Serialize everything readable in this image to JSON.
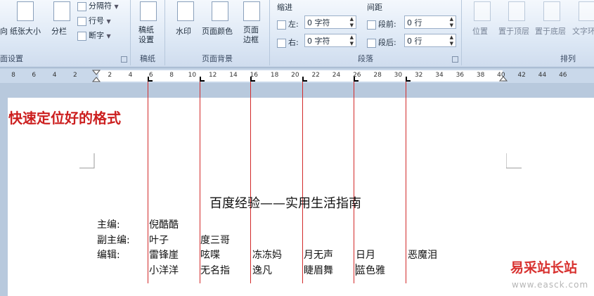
{
  "ribbon": {
    "page_setup": {
      "label": "面设置",
      "left_label": "向",
      "paper_size": "纸张大小",
      "columns": "分栏",
      "breaks": "分隔符",
      "line_numbers": "行号",
      "hyphenation": "断字"
    },
    "draft": {
      "label": "稿纸",
      "button": "稿纸设置"
    },
    "page_background": {
      "label": "页面背景",
      "watermark": "水印",
      "page_color": "页面颜色",
      "page_borders": "页面边框"
    },
    "paragraph": {
      "label": "段落",
      "indent_title": "缩进",
      "spacing_title": "间距",
      "left_label": "左:",
      "left_value": "0 字符",
      "right_label": "右:",
      "right_value": "0 字符",
      "before_label": "段前:",
      "before_value": "0 行",
      "after_label": "段后:",
      "after_value": "0 行"
    },
    "arrange": {
      "label": "排列",
      "position": "位置",
      "bring_front": "置于顶层",
      "send_back": "置于底层",
      "text_wrap": "文字环"
    }
  },
  "ruler": {
    "ticks": [
      "8",
      "6",
      "4",
      "2",
      "2",
      "4",
      "6",
      "8",
      "10",
      "12",
      "14",
      "16",
      "18",
      "20",
      "22",
      "24",
      "26",
      "28",
      "30",
      "32",
      "34",
      "36",
      "38",
      "40",
      "42",
      "44",
      "46"
    ]
  },
  "document": {
    "tip": "快速定位好的格式",
    "title": "百度经验——实用生活指南",
    "rows": [
      {
        "label": "主编:",
        "cells": [
          "倪酷酷"
        ]
      },
      {
        "label": "副主编:",
        "cells": [
          "叶子",
          "度三哥"
        ]
      },
      {
        "label": "编辑:",
        "cells": [
          "雷锋崖",
          "呟喋",
          "冻冻妈",
          "月无声",
          "日月",
          "恶魔泪"
        ]
      },
      {
        "label": "",
        "cells": [
          "小洋洋",
          "无名指",
          "逸凡",
          "睫眉舞",
          "蓝色雅"
        ]
      }
    ]
  },
  "watermark": {
    "text": "易采站长站",
    "url": "www.easck.com"
  },
  "colors": {
    "guide_line": "#d22a2a",
    "tip_text": "#cc1f1f"
  }
}
